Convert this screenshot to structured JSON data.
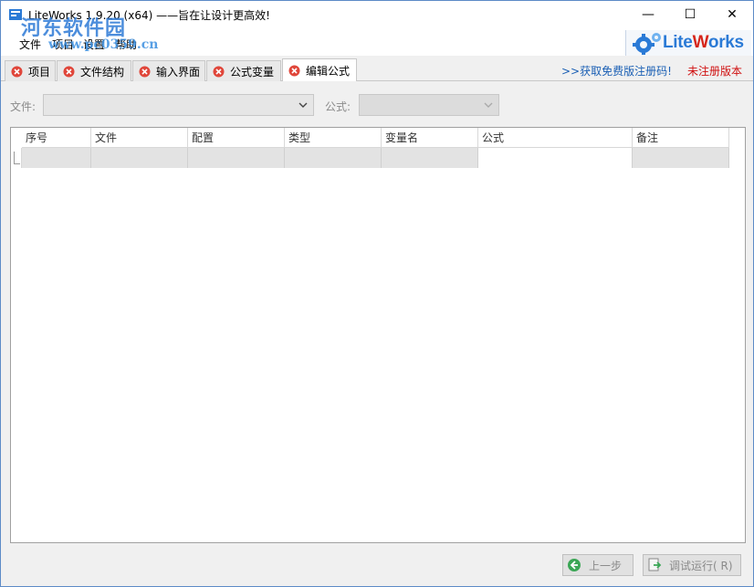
{
  "window": {
    "title": "LiteWorks 1.9.20 (x64) ——旨在让设计更高效!",
    "minimize_glyph": "—",
    "maximize_glyph": "☐",
    "close_glyph": "✕"
  },
  "menu": {
    "items": [
      "文件",
      "项目",
      "设置",
      "帮助"
    ]
  },
  "watermark": {
    "name": "河东软件园",
    "url": "www.pc0359.cn"
  },
  "brand": {
    "part1": "Lite",
    "part2": "W",
    "part3": "orks",
    "accent": "#2a7ad6",
    "accent2": "#d6261b"
  },
  "tabs": [
    {
      "label": "项目",
      "active": false
    },
    {
      "label": "文件结构",
      "active": false
    },
    {
      "label": "输入界面",
      "active": false
    },
    {
      "label": "公式变量",
      "active": false
    },
    {
      "label": "编辑公式",
      "active": true
    }
  ],
  "registration": {
    "link_text": ">>获取免费版注册码!",
    "status_text": "未注册版本",
    "link_color": "#1a5fb4",
    "status_color": "#d01010"
  },
  "filters": {
    "file_label": "文件:",
    "formula_label": "公式:",
    "file_value": "",
    "formula_value": ""
  },
  "grid": {
    "columns": [
      "序号",
      "文件",
      "配置",
      "类型",
      "变量名",
      "公式",
      "备注"
    ],
    "rows": [
      [
        "",
        "",
        "",
        "",
        "",
        "",
        ""
      ]
    ]
  },
  "buttons": {
    "prev": "上一步",
    "run": "调试运行( R)"
  }
}
